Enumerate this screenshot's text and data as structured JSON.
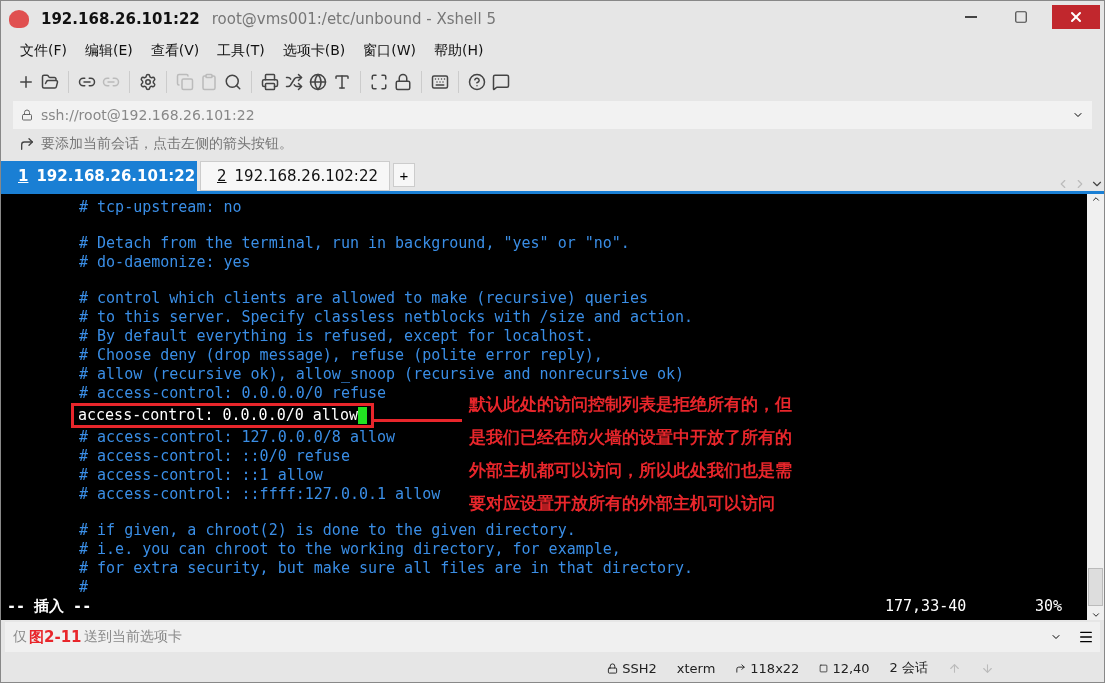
{
  "window": {
    "title_bold": "192.168.26.101:22",
    "title": "root@vms001:/etc/unbound - Xshell 5"
  },
  "menu": [
    "文件(F)",
    "编辑(E)",
    "查看(V)",
    "工具(T)",
    "选项卡(B)",
    "窗口(W)",
    "帮助(H)"
  ],
  "address": {
    "value": "ssh://root@192.168.26.101:22"
  },
  "hint": "要添加当前会话，点击左侧的箭头按钮。",
  "tabs": [
    {
      "number": "1",
      "label": "192.168.26.101:22",
      "selected": true
    },
    {
      "number": "2",
      "label": "192.168.26.102:22",
      "selected": false
    }
  ],
  "new_tab": "+",
  "terminal": {
    "lines": [
      {
        "kind": "comment",
        "text": "# tcp-upstream: no"
      },
      {
        "kind": "blank"
      },
      {
        "kind": "comment",
        "text": "# Detach from the terminal, run in background, \"yes\" or \"no\"."
      },
      {
        "kind": "comment",
        "text": "# do-daemonize: yes"
      },
      {
        "kind": "blank"
      },
      {
        "kind": "comment",
        "text": "# control which clients are allowed to make (recursive) queries"
      },
      {
        "kind": "comment",
        "text": "# to this server. Specify classless netblocks with /size and action."
      },
      {
        "kind": "comment",
        "text": "# By default everything is refused, except for localhost."
      },
      {
        "kind": "comment",
        "text": "# Choose deny (drop message), refuse (polite error reply),"
      },
      {
        "kind": "comment",
        "text": "# allow (recursive ok), allow_snoop (recursive and nonrecursive ok)"
      },
      {
        "kind": "comment",
        "text": "# access-control: 0.0.0.0/0 refuse"
      },
      {
        "kind": "highlighted",
        "text": "access-control: 0.0.0.0/0 allow"
      },
      {
        "kind": "comment",
        "text": "# access-control: 127.0.0.0/8 allow"
      },
      {
        "kind": "comment",
        "text": "# access-control: ::0/0 refuse"
      },
      {
        "kind": "comment",
        "text": "# access-control: ::1 allow"
      },
      {
        "kind": "comment",
        "text": "# access-control: ::ffff:127.0.0.1 allow"
      },
      {
        "kind": "blank"
      },
      {
        "kind": "comment",
        "text": "# if given, a chroot(2) is done to the given directory."
      },
      {
        "kind": "comment",
        "text": "# i.e. you can chroot to the working directory, for example,"
      },
      {
        "kind": "comment",
        "text": "# for extra security, but make sure all files are in that directory."
      },
      {
        "kind": "comment",
        "text": "#"
      }
    ],
    "mode": "-- 插入 --",
    "position": "177,33-40",
    "percent": "30%"
  },
  "annotation": [
    "默认此处的访问控制列表是拒绝所有的，但",
    "是我们已经在防火墙的设置中开放了所有的",
    "外部主机都可以访问，所以此处我们也是需",
    "要对应设置开放所有的外部主机可以访问"
  ],
  "send_bar": {
    "placeholder_start": "仅",
    "figure_label": "图2-11",
    "placeholder_end": "送到当前选项卡"
  },
  "status_bar": {
    "protocol": "SSH2",
    "terminal": "xterm",
    "size": "118x22",
    "cursor": "12,40",
    "sessions": "2 会话"
  }
}
